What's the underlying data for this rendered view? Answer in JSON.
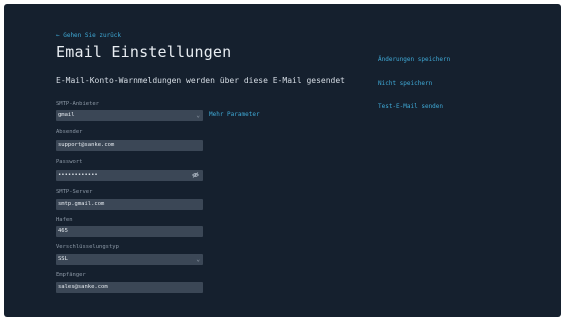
{
  "nav": {
    "back_label": "← Gehen Sie zurück"
  },
  "page": {
    "title": "Email Einstellungen",
    "subtitle": "E-Mail-Konto-Warnmeldungen werden über diese E-Mail gesendet"
  },
  "form": {
    "smtp_provider": {
      "label": "SMTP-Anbieter",
      "value": "gmail"
    },
    "more_params_label": "Mehr Parameter",
    "sender": {
      "label": "Absender",
      "value": "support@sanke.com"
    },
    "password": {
      "label": "Passwort",
      "value": "••••••••••••"
    },
    "smtp_server": {
      "label": "SMTP-Server",
      "value": "smtp.gmail.com"
    },
    "port": {
      "label": "Hafen",
      "value": "465"
    },
    "encryption": {
      "label": "Verschlüsselungstyp",
      "value": "SSL"
    },
    "recipient": {
      "label": "Empfänger",
      "value": "sales@sanke.com"
    }
  },
  "actions": {
    "save_changes": "Änderungen speichern",
    "dont_save": "Nicht speichern",
    "send_test": "Test-E-Mail senden"
  },
  "colors": {
    "background": "#15202e",
    "field": "#3b4756",
    "accent": "#3fa9d6",
    "text": "#e8edf2",
    "label": "#8c98a6"
  },
  "icons": {
    "dropdown": "chevron-down-icon",
    "password_toggle": "eye-off-icon"
  }
}
